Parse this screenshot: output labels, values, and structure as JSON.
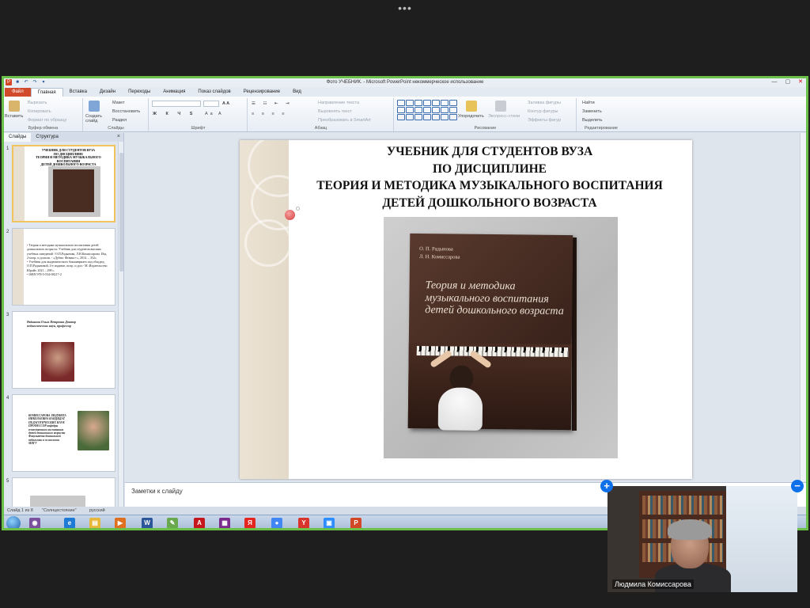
{
  "window": {
    "title": "Фото УЧЕБНИК.  -  Microsoft PowerPoint некоммерческое использование"
  },
  "ribbon_tabs": [
    "Файл",
    "Главная",
    "Вставка",
    "Дизайн",
    "Переходы",
    "Анимация",
    "Показ слайдов",
    "Рецензирование",
    "Вид"
  ],
  "ribbon": {
    "clipboard": {
      "paste": "Вставить",
      "cut": "Вырезать",
      "copy": "Копировать",
      "format_painter": "Формат по образцу",
      "label": "Буфер обмена"
    },
    "slides": {
      "new_slide": "Создать слайд",
      "layout": "Макет",
      "reset": "Восстановить",
      "section": "Раздел",
      "label": "Слайды"
    },
    "font": {
      "label": "Шрифт"
    },
    "paragraph": {
      "text_direction": "Направление текста",
      "align_text": "Выровнять текст",
      "smartart": "Преобразовать в SmartArt",
      "label": "Абзац"
    },
    "drawing": {
      "arrange": "Упорядочить",
      "quick_styles": "Экспресс-стили",
      "shape_fill": "Заливка фигуры",
      "shape_outline": "Контур фигуры",
      "shape_effects": "Эффекты фигур",
      "label": "Рисование"
    },
    "editing": {
      "find": "Найти",
      "replace": "Заменить",
      "select": "Выделить",
      "label": "Редактирование"
    }
  },
  "slides_pane": {
    "tabs": [
      "Слайды",
      "Структура"
    ],
    "close_glyph": "×",
    "thumbs": [
      {
        "num": "1",
        "title_lines": [
          "УЧЕБНИК ДЛЯ СТУДЕНТОВ ВУЗА",
          "ПО ДИСЦИПЛИНЕ",
          "ТЕОРИЯ И МЕТОДИКА МУЗЫКАЛЬНОГО ВОСПИТАНИЯ",
          "ДЕТЕЙ ДОШКОЛЬНОГО ВОЗРАСТА"
        ]
      },
      {
        "num": "2",
        "bullets": [
          "Теория и методика музыкального воспитания детей дошкольного возраста: Учебник для студентов высших учебных заведений / О.П.Радынова, Л.Н.Комиссарова. Изд. 2-испр. и дополн. - «Дубна: Феникс+», 2014. – 352с.",
          "Учебник для академического бакалавриата под общ.ред. О.П.Радыновой, 4-е издание, испр. и доп.- М.:Издательство Юрайт, 2021 – 298 с.",
          "ISBN 978-5-534-08217-2"
        ]
      },
      {
        "num": "3",
        "text": "Радынова Ольга Петровна Доктор педагогических наук, профессор"
      },
      {
        "num": "4",
        "text": "КОМИССАРОВА ЛЮДМИЛА НИКОЛАЕВНА КАНДИДАТ ПЕДАГОГИЧЕСКИХ НАУК ПРОФЕССОР кафедры естественного воспитания детей дошкольного возраста Факультета дошкольной педагогики и психологии МПГУ"
      },
      {
        "num": "5"
      }
    ]
  },
  "slide": {
    "title_lines": [
      "УЧЕБНИК ДЛЯ СТУДЕНТОВ ВУЗА",
      "ПО ДИСЦИПЛИНЕ",
      "ТЕОРИЯ И МЕТОДИКА МУЗЫКАЛЬНОГО ВОСПИТАНИЯ",
      "ДЕТЕЙ ДОШКОЛЬНОГО ВОЗРАСТА"
    ],
    "book": {
      "author1": "О. П. Радынова",
      "author2": "Л. Н. Комиссарова",
      "title": "Теория и методика музыкального воспитания детей дошкольного возраста"
    }
  },
  "notes": {
    "placeholder": "Заметки к слайду"
  },
  "statusbar": {
    "slide_counter": "Слайд 1 из 8",
    "theme": "\"Солнцестояние\"",
    "language": "русский"
  },
  "taskbar": {
    "icons": [
      {
        "name": "viber-icon",
        "glyph": "◉",
        "color": "#7b519d"
      },
      {
        "name": "ie-icon",
        "glyph": "e",
        "color": "#1d7bd6"
      },
      {
        "name": "explorer-icon",
        "glyph": "▤",
        "color": "#e8b738"
      },
      {
        "name": "media-player-icon",
        "glyph": "▶",
        "color": "#e0701f"
      },
      {
        "name": "word-icon",
        "glyph": "W",
        "color": "#2b579a"
      },
      {
        "name": "paint-icon",
        "glyph": "✎",
        "color": "#6aa84f"
      },
      {
        "name": "acrobat-icon",
        "glyph": "A",
        "color": "#c4161c"
      },
      {
        "name": "winrar-icon",
        "glyph": "▦",
        "color": "#7a2b8c"
      },
      {
        "name": "yandex-icon",
        "glyph": "Я",
        "color": "#e52620"
      },
      {
        "name": "chrome-icon",
        "glyph": "●",
        "color": "#4285f4"
      },
      {
        "name": "yandex-browser-icon",
        "glyph": "Y",
        "color": "#d9342b"
      },
      {
        "name": "zoom-icon",
        "glyph": "▣",
        "color": "#2d8cff"
      },
      {
        "name": "powerpoint-icon",
        "glyph": "P",
        "color": "#d24726"
      }
    ]
  },
  "participant": {
    "name": "Людмила Комиссарова",
    "plus_glyph": "+",
    "minus_glyph": "−"
  },
  "zoom_bar": {
    "more_glyph": "•••"
  }
}
